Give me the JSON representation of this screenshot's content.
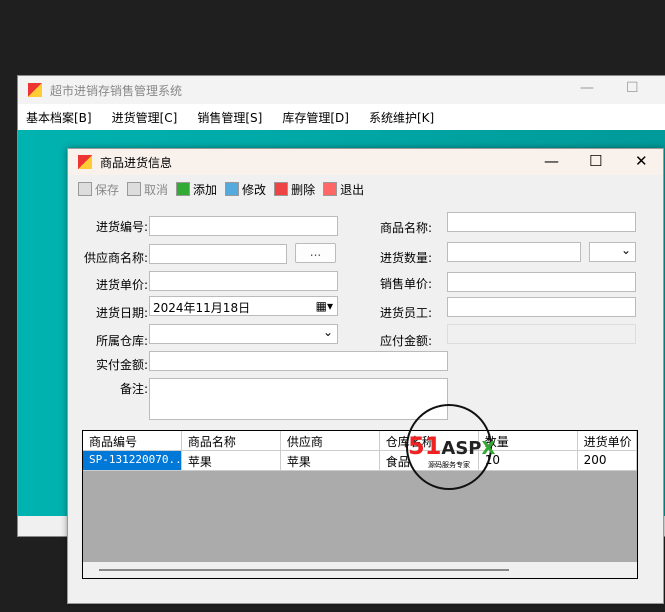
{
  "main": {
    "title": "超市进销存销售管理系统",
    "menu": [
      "基本档案[B]",
      "进货管理[C]",
      "销售管理[S]",
      "库存管理[D]",
      "系统维护[K]"
    ]
  },
  "dialog": {
    "title": "商品进货信息",
    "toolbar": {
      "save": "保存",
      "cancel": "取消",
      "add": "添加",
      "edit": "修改",
      "delete": "删除",
      "exit": "退出"
    },
    "form": {
      "purchase_no": "进货编号:",
      "supplier": "供应商名称:",
      "unit_price": "进货单价:",
      "date": "进货日期:",
      "date_value": "2024年11月18日",
      "warehouse": "所属仓库:",
      "paid": "实付金额:",
      "remark": "备注:",
      "product_name": "商品名称:",
      "qty": "进货数量:",
      "sale_price": "销售单价:",
      "staff": "进货员工:",
      "payable": "应付金额:",
      "browse": "..."
    },
    "grid": {
      "columns": [
        "商品编号",
        "商品名称",
        "供应商",
        "仓库名称",
        "数量",
        "进货单价"
      ],
      "rows": [
        [
          "SP-131220070...",
          "苹果",
          "苹果",
          "食品",
          "10",
          "200"
        ]
      ]
    }
  },
  "watermark": {
    "text": "51ASPX",
    "sub": "源码服务专家"
  }
}
